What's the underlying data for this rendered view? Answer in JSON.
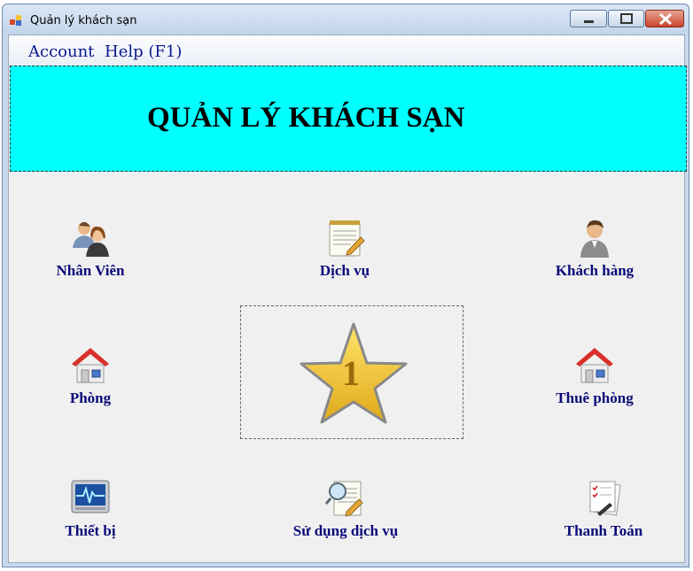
{
  "window": {
    "title": "Quản lý khách sạn"
  },
  "menu": {
    "items": [
      {
        "label": "Account"
      },
      {
        "label": "Help (F1)"
      }
    ]
  },
  "banner": {
    "title": "QUẢN LÝ KHÁCH SẠN",
    "background": "#00ffff"
  },
  "tiles": {
    "nhan_vien": {
      "label": "Nhân Viên",
      "icon": "users-icon"
    },
    "dich_vu": {
      "label": "Dịch vụ",
      "icon": "notepad-icon"
    },
    "khach_hang": {
      "label": "Khách hàng",
      "icon": "user-icon"
    },
    "phong": {
      "label": "Phòng",
      "icon": "house-icon"
    },
    "thue_phong": {
      "label": "Thuê phòng",
      "icon": "house-icon"
    },
    "thiet_bi": {
      "label": "Thiết bị",
      "icon": "monitor-icon"
    },
    "su_dung_dich_vu": {
      "label": "Sử dụng dịch vụ",
      "icon": "search-document-icon"
    },
    "thanh_toan": {
      "label": "Thanh Toán",
      "icon": "checklist-icon"
    }
  },
  "center": {
    "icon": "gold-star-icon",
    "number": "1"
  },
  "colors": {
    "label": "#0a0a7a",
    "menu_text": "#0a1a8c",
    "client_bg": "#f0f0f0"
  }
}
